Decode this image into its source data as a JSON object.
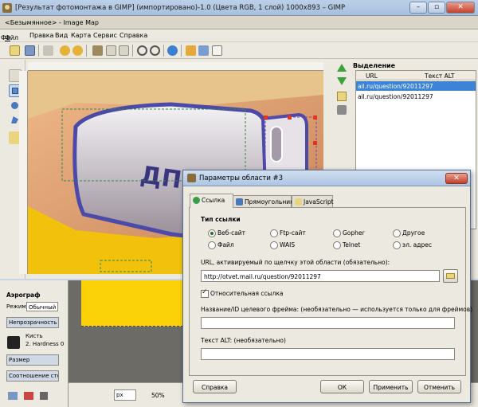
{
  "gimp": {
    "title": "[Результат фотомонтажа в GIMP] (импортировано)-1.0 (Цвета RGB, 1 слой) 1000x893 – GIMP",
    "window_buttons": [
      "–",
      "▫",
      "✕"
    ]
  },
  "imagemap": {
    "title": "<Безымянное> - Image Map",
    "menu": [
      {
        "label": "Файл",
        "key": "Ф"
      },
      {
        "label": "Правка",
        "key": "П"
      },
      {
        "label": "Вид",
        "key": "В"
      },
      {
        "label": "Карта",
        "key": "К"
      },
      {
        "label": "Сервис",
        "key": "С"
      },
      {
        "label": "Справка",
        "key": "С"
      }
    ],
    "selection": {
      "title": "Выделение",
      "columns": [
        "URL",
        "Текст ALT"
      ],
      "rows": [
        "ail.ru/question/92011297",
        "ail.ru/question/92011297"
      ]
    },
    "canvas_text": "ДПС"
  },
  "toolbox": {
    "title": "Аэрограф",
    "mode_label": "Режим:",
    "mode_value": "Обычный",
    "opacity_label": "Непрозрачность",
    "brush_label": "Кисть",
    "brush_value": "2. Hardness 0",
    "size_label": "Размер",
    "aspect_label": "Соотношение сто..."
  },
  "statusbar": {
    "unit": "px",
    "zoom": "50%"
  },
  "dialog": {
    "title": "Параметры области #3",
    "tabs": [
      "Ссылка",
      "Прямоугольник",
      "JavaScript"
    ],
    "link_type_title": "Тип ссылки",
    "link_types": [
      "Веб-сайт",
      "Ftp-сайт",
      "Gopher",
      "Другое",
      "Файл",
      "WAIS",
      "Telnet",
      "эл. адрес"
    ],
    "selected_link_type": "Веб-сайт",
    "url_label": "URL, активируемый по щелчку этой области (обязательно):",
    "url_value": "http://otvet.mail.ru/question/92011297",
    "relative_label": "Относительная ссылка",
    "relative_checked": true,
    "frame_label": "Название/ID целевого фрейма: (необязательно — используется только для фреймов)",
    "frame_value": "",
    "alt_label": "Текст ALT: (необязательно)",
    "alt_value": "",
    "buttons": {
      "help": "Справка",
      "ok": "ОК",
      "apply": "Применить",
      "cancel": "Отменить"
    }
  }
}
